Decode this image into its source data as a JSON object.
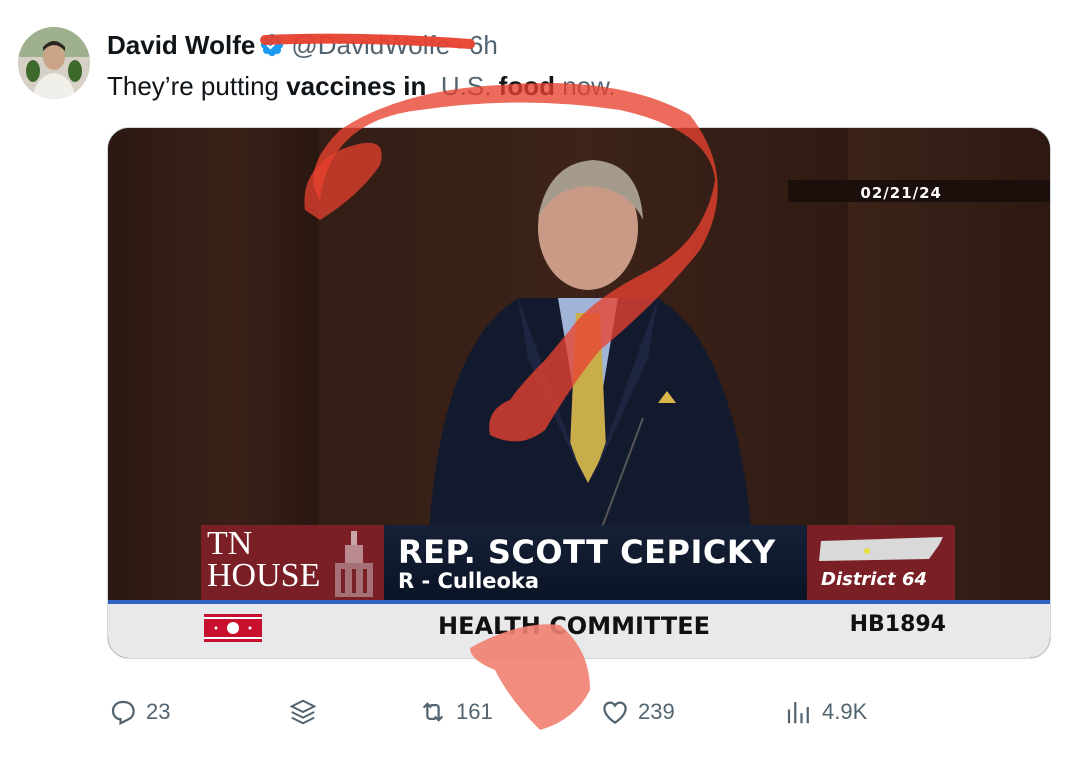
{
  "tweet": {
    "author_name": "David Wolfe",
    "handle": "@DavidWolfe",
    "separator": "·",
    "time": "6h",
    "text_part1": "They’re putting ",
    "text_bold1": "vaccines in",
    "text_part2": "  U.S. ",
    "text_bold2": "food",
    "text_part3": " now."
  },
  "video": {
    "date": "02/21/24",
    "tn_line1": "TN",
    "tn_line2": "HOUSE",
    "rep_name": "REP. SCOTT CEPICKY",
    "rep_party": "R - Culleoka",
    "district": "District 64",
    "committee": "HEALTH COMMITTEE",
    "bill": "HB1894"
  },
  "actions": {
    "replies": "23",
    "reposts": "161",
    "likes": "239",
    "views": "4.9K"
  },
  "colors": {
    "verified": "#1d9bf0",
    "scribble": "#e8412f",
    "secondary_text": "#536471"
  }
}
